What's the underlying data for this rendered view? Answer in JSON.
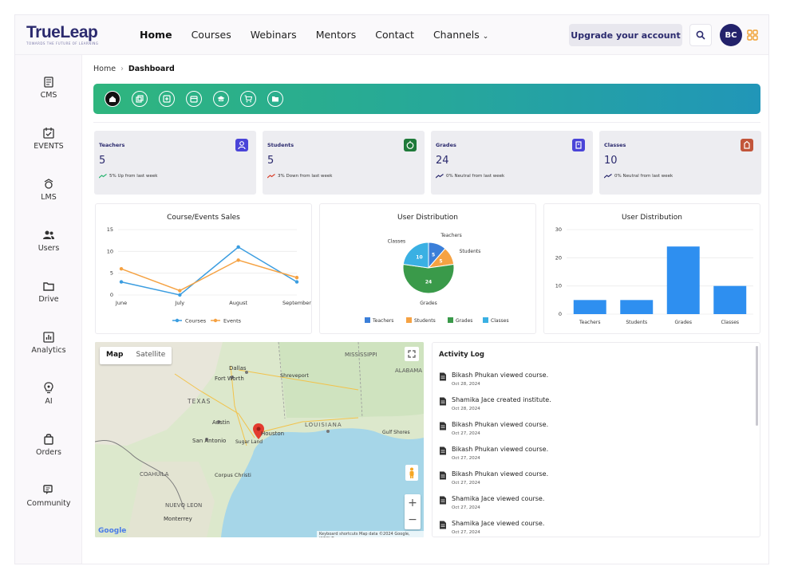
{
  "header": {
    "logo": "TrueLeap",
    "tagline": "TOWARDS THE FUTURE OF LEARNING",
    "nav": [
      "Home",
      "Courses",
      "Webinars",
      "Mentors",
      "Contact",
      "Channels"
    ],
    "upgrade_label": "Upgrade your account",
    "avatar_initials": "BC"
  },
  "sidebar": {
    "items": [
      {
        "label": "CMS",
        "icon": "cms-icon"
      },
      {
        "label": "EVENTS",
        "icon": "calendar-check-icon"
      },
      {
        "label": "LMS",
        "icon": "lms-icon"
      },
      {
        "label": "Users",
        "icon": "users-icon"
      },
      {
        "label": "Drive",
        "icon": "folder-icon"
      },
      {
        "label": "Analytics",
        "icon": "analytics-icon"
      },
      {
        "label": "AI",
        "icon": "ai-icon"
      },
      {
        "label": "Orders",
        "icon": "bag-icon"
      },
      {
        "label": "Community",
        "icon": "chat-icon"
      }
    ]
  },
  "breadcrumb": {
    "home": "Home",
    "current": "Dashboard"
  },
  "stats": [
    {
      "label": "Teachers",
      "value": "5",
      "trend": "5% Up from last week",
      "color": "#4a44d8"
    },
    {
      "label": "Students",
      "value": "5",
      "trend": "3% Down from last week",
      "color": "#1f7a3a"
    },
    {
      "label": "Grades",
      "value": "24",
      "trend": "0% Neutral from last week",
      "color": "#4a44d8"
    },
    {
      "label": "Classes",
      "value": "10",
      "trend": "0% Neutral from last week",
      "color": "#c2553a"
    }
  ],
  "chart_data": [
    {
      "type": "line",
      "title": "Course/Events Sales",
      "categories": [
        "June",
        "July",
        "August",
        "September"
      ],
      "ylim": [
        0,
        15
      ],
      "yticks": [
        0,
        5,
        10,
        15
      ],
      "series": [
        {
          "name": "Courses",
          "values": [
            3,
            0,
            11,
            3
          ],
          "color": "#3b9de0"
        },
        {
          "name": "Events",
          "values": [
            6,
            1,
            8,
            4
          ],
          "color": "#f5a243"
        }
      ]
    },
    {
      "type": "pie",
      "title": "User Distribution",
      "slices": [
        {
          "label": "Teachers",
          "value": 5,
          "color": "#3b7fd9"
        },
        {
          "label": "Students",
          "value": 5,
          "color": "#f5a243"
        },
        {
          "label": "Grades",
          "value": 24,
          "color": "#3a9a4a"
        },
        {
          "label": "Classes",
          "value": 10,
          "color": "#3ab0e3"
        }
      ]
    },
    {
      "type": "bar",
      "title": "User Distribution",
      "categories": [
        "Teachers",
        "Students",
        "Grades",
        "Classes"
      ],
      "values": [
        5,
        5,
        24,
        10
      ],
      "ylim": [
        0,
        30
      ],
      "yticks": [
        0,
        10,
        20,
        30
      ],
      "color": "#2e8ff0"
    }
  ],
  "map": {
    "tab_map": "Map",
    "tab_satellite": "Satellite",
    "places": [
      "MISSISSIPPI",
      "ALABAMA",
      "Dallas",
      "Fort Worth",
      "TEXAS",
      "Austin",
      "San Antonio",
      "Houston",
      "LOUISIANA",
      "COAHUILA",
      "NUEVO LEON",
      "Monterrey",
      "Corpus Christi",
      "Shreveport",
      "Sugar Land",
      "Gulf Shores"
    ],
    "footer": "Keyboard shortcuts   Map data ©2024 Google, INEGI   Terms",
    "brand": "Google"
  },
  "activity": {
    "title": "Activity Log",
    "items": [
      {
        "text": "Bikash Phukan viewed course.",
        "date": "Oct 28, 2024"
      },
      {
        "text": "Shamika Jace created institute.",
        "date": "Oct 28, 2024"
      },
      {
        "text": "Bikash Phukan viewed course.",
        "date": "Oct 27, 2024"
      },
      {
        "text": "Bikash Phukan viewed course.",
        "date": "Oct 27, 2024"
      },
      {
        "text": "Bikash Phukan viewed course.",
        "date": "Oct 27, 2024"
      },
      {
        "text": "Shamika Jace viewed course.",
        "date": "Oct 27, 2024"
      },
      {
        "text": "Shamika Jace viewed course.",
        "date": "Oct 27, 2024"
      }
    ]
  }
}
